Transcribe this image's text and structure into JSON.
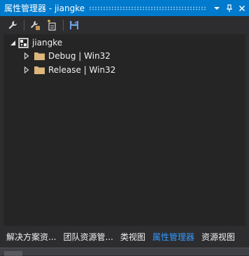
{
  "window": {
    "title": "属性管理器 - jiangke"
  },
  "tree": {
    "root": {
      "label": "jiangke",
      "expanded": true
    },
    "children": [
      {
        "label": "Debug | Win32",
        "expanded": false
      },
      {
        "label": "Release | Win32",
        "expanded": false
      }
    ]
  },
  "tabs": [
    {
      "label": "解决方案资...",
      "active": false
    },
    {
      "label": "团队资源管...",
      "active": false
    },
    {
      "label": "类视图",
      "active": false
    },
    {
      "label": "属性管理器",
      "active": true
    },
    {
      "label": "资源视图",
      "active": false
    }
  ],
  "colors": {
    "title_bar": "#007acc",
    "panel_bg": "#2d2d30",
    "tree_bg": "#252526",
    "active_tab": "#3399ff",
    "folder": "#dcb67a"
  },
  "icons": {
    "toolbar": [
      "wrench-icon",
      "add-existing-property-sheet-icon",
      "add-new-property-sheet-icon",
      "save-icon"
    ],
    "title": [
      "dropdown-arrow-icon",
      "pin-icon",
      "close-icon"
    ]
  }
}
